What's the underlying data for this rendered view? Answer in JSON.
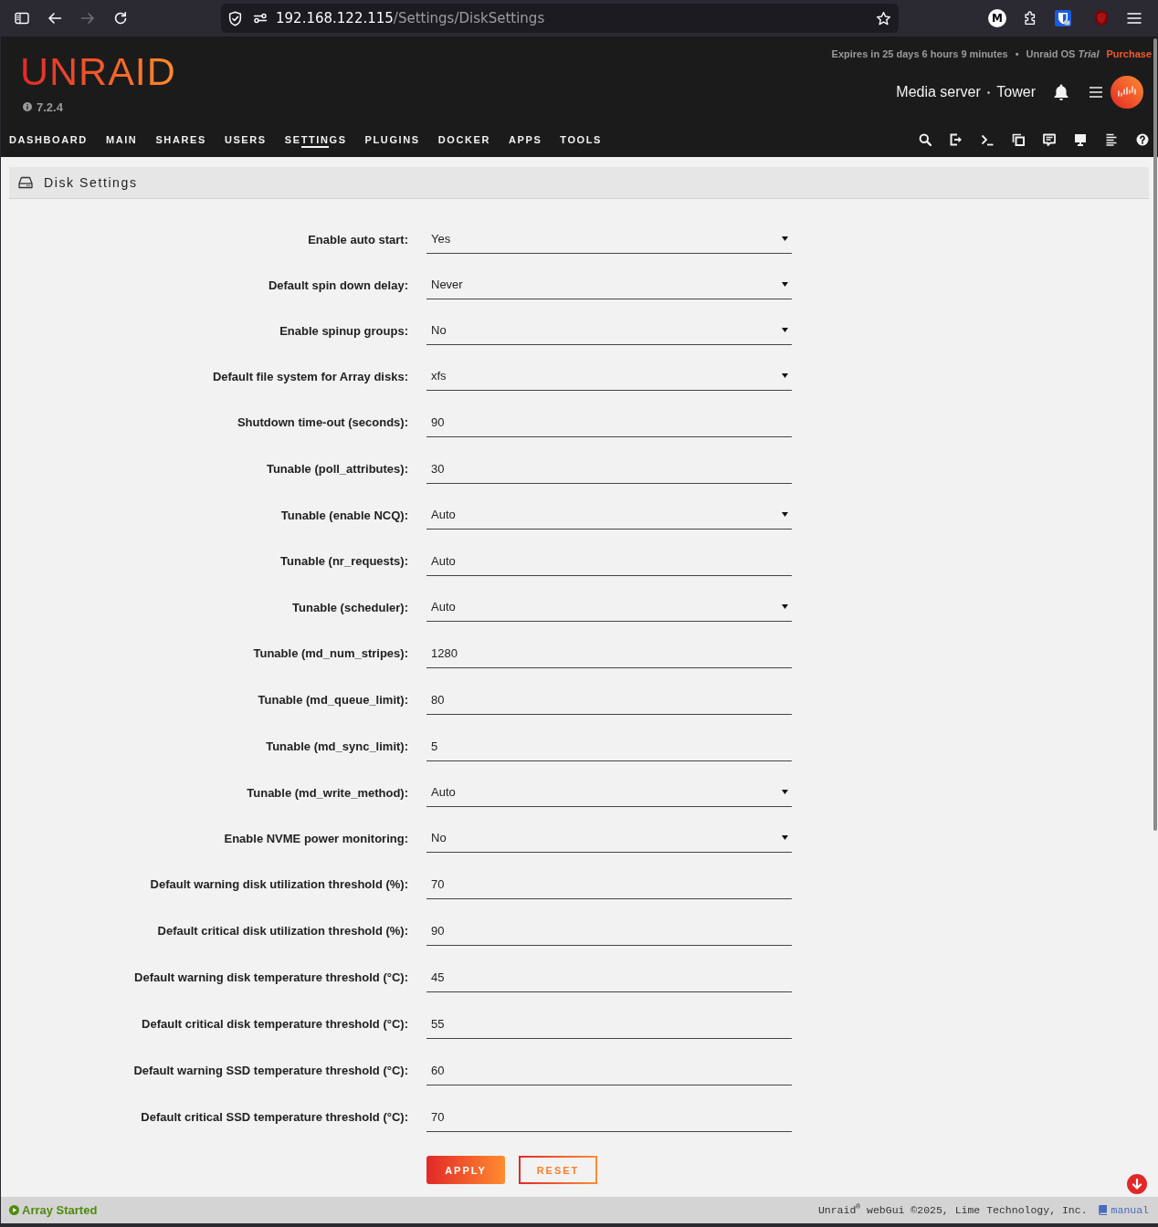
{
  "browser": {
    "forward_disabled": true,
    "url_host": "192.168.122.115",
    "url_path": "/Settings/DiskSettings",
    "profile_initial": "M"
  },
  "header": {
    "logo": "UNRAID",
    "version": "7.2.4",
    "registration": "Expires in 25 days 6 hours 9 minutes",
    "separator": "•",
    "license": "Unraid OS *Trial*",
    "purchase_link": "Purchase",
    "server_description": "Media server",
    "server_separator": "•",
    "server_name": "Tower"
  },
  "nav": {
    "tabs": [
      {
        "label": "DASHBOARD",
        "selected": false
      },
      {
        "label": "MAIN",
        "selected": false
      },
      {
        "label": "SHARES",
        "selected": false
      },
      {
        "label": "USERS",
        "selected": false
      },
      {
        "label": "SETTINGS",
        "selected": true
      },
      {
        "label": "PLUGINS",
        "selected": false
      },
      {
        "label": "DOCKER",
        "selected": false
      },
      {
        "label": "APPS",
        "selected": false
      },
      {
        "label": "TOOLS",
        "selected": false
      }
    ]
  },
  "panel": {
    "title": "Disk Settings"
  },
  "settings": [
    {
      "label": "Enable auto start:",
      "kind": "select",
      "value": "Yes"
    },
    {
      "label": "Default spin down delay:",
      "kind": "select",
      "value": "Never"
    },
    {
      "label": "Enable spinup groups:",
      "kind": "select",
      "value": "No"
    },
    {
      "label": "Default file system for Array disks:",
      "kind": "select",
      "value": "xfs"
    },
    {
      "label": "Shutdown time-out (seconds):",
      "kind": "input",
      "value": "90"
    },
    {
      "label": "Tunable (poll_attributes):",
      "kind": "input",
      "value": "30"
    },
    {
      "label": "Tunable (enable NCQ):",
      "kind": "select",
      "value": "Auto"
    },
    {
      "label": "Tunable (nr_requests):",
      "kind": "input",
      "value": "Auto"
    },
    {
      "label": "Tunable (scheduler):",
      "kind": "select",
      "value": "Auto"
    },
    {
      "label": "Tunable (md_num_stripes):",
      "kind": "input",
      "value": "1280"
    },
    {
      "label": "Tunable (md_queue_limit):",
      "kind": "input",
      "value": "80"
    },
    {
      "label": "Tunable (md_sync_limit):",
      "kind": "input",
      "value": "5"
    },
    {
      "label": "Tunable (md_write_method):",
      "kind": "select",
      "value": "Auto"
    },
    {
      "label": "Enable NVME power monitoring:",
      "kind": "select",
      "value": "No"
    },
    {
      "label": "Default warning disk utilization threshold (%):",
      "kind": "input",
      "value": "70"
    },
    {
      "label": "Default critical disk utilization threshold (%):",
      "kind": "input",
      "value": "90"
    },
    {
      "label": "Default warning disk temperature threshold (°C):",
      "kind": "input",
      "value": "45"
    },
    {
      "label": "Default critical disk temperature threshold (°C):",
      "kind": "input",
      "value": "55"
    },
    {
      "label": "Default warning SSD temperature threshold (°C):",
      "kind": "input",
      "value": "60"
    },
    {
      "label": "Default critical SSD temperature threshold (°C):",
      "kind": "input",
      "value": "70"
    }
  ],
  "buttons": [
    {
      "label": "APPLY",
      "kind": "primary"
    },
    {
      "label": "RESET",
      "kind": "outline"
    }
  ],
  "status_bar": {
    "array_status": "Array Started",
    "copyright": "Unraid$^{®}$ webGui ©2025, Lime Technology, Inc.",
    "manual_link": "manual"
  }
}
